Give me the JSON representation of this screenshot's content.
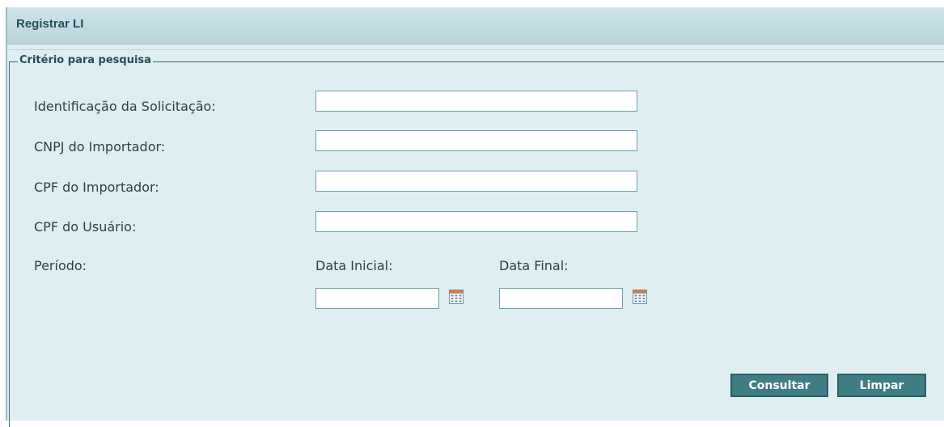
{
  "panel": {
    "title": "Registrar LI"
  },
  "fieldset": {
    "legend": "Critério para pesquisa",
    "fields": [
      {
        "label": "Identificação da Solicitação:",
        "value": ""
      },
      {
        "label": "CNPJ do Importador:",
        "value": ""
      },
      {
        "label": "CPF do Importador:",
        "value": ""
      },
      {
        "label": "CPF do Usuário:",
        "value": ""
      }
    ],
    "period": {
      "label": "Período:",
      "start_label": "Data Inicial:",
      "start_value": "",
      "end_label": "Data Final:",
      "end_value": "",
      "icon": "calendar-icon"
    }
  },
  "buttons": {
    "consultar": "Consultar",
    "limpar": "Limpar"
  },
  "colors": {
    "panel_background": "#deeef1",
    "header_background": "#c3dde2",
    "title_text": "#274f5a",
    "button_background": "#3f7d85",
    "input_border": "#6f9ea8"
  }
}
